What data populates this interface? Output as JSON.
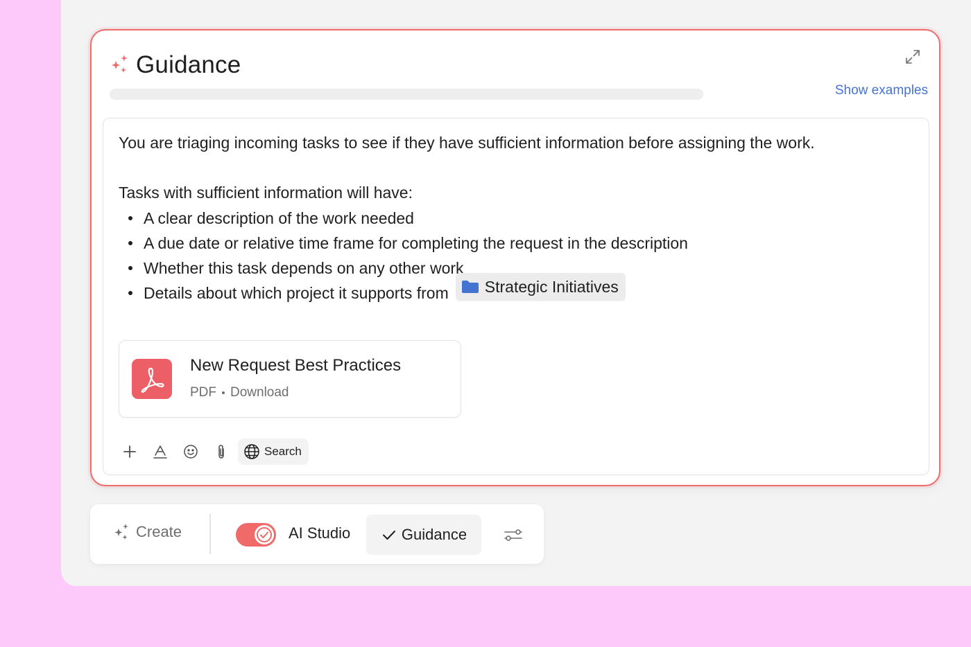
{
  "colors": {
    "accent": "#f06a6a",
    "link": "#4573d2",
    "background": "#fdc9fb",
    "folder": "#4573d2",
    "pdf": "#ec5f67"
  },
  "panel": {
    "title": "Guidance",
    "title_icon": "sparkle-icon",
    "show_examples": "Show examples",
    "expand_icon": "expand-icon"
  },
  "editor": {
    "intro": "You are triaging incoming tasks to see if they have sufficient information before assigning the work.",
    "criteria_heading": "Tasks with sufficient information will have:",
    "bullets": [
      "A clear description of the work needed",
      "A due date or relative time frame for completing the request in the description",
      "Whether this task depends on any other work",
      "Details about which project it supports from"
    ],
    "project_chip": {
      "icon": "folder-icon",
      "label": "Strategic Initiatives"
    },
    "attachment": {
      "icon": "pdf-icon",
      "name": "New Request Best Practices",
      "type": "PDF",
      "action": "Download"
    },
    "toolbar": {
      "icons": [
        "plus-icon",
        "text-format-icon",
        "emoji-icon",
        "paperclip-icon",
        "globe-icon"
      ],
      "search_label": "Search"
    }
  },
  "bottombar": {
    "create_label": "Create",
    "toggle_on": true,
    "ai_studio_label": "AI Studio",
    "guidance_label": "Guidance",
    "settings_icon": "sliders-icon"
  }
}
